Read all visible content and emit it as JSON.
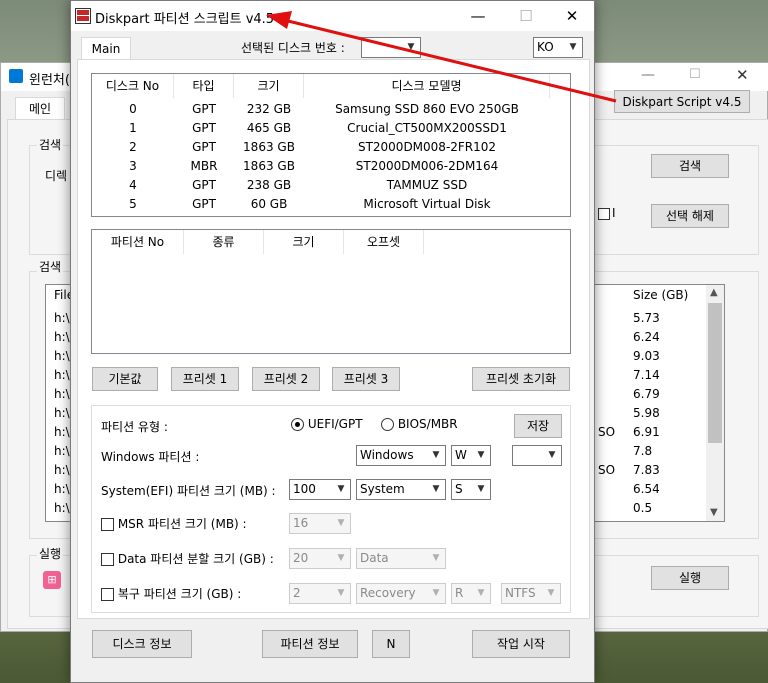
{
  "back_window": {
    "title": "윈런처(",
    "tab_main": "메인",
    "group_search_label": "검색 ",
    "directory_label": "디렉",
    "group_results_label": "검색 ",
    "search_button": "검색",
    "deselect_button": "선택 해제",
    "checkbox_suffix": "I",
    "list_header_file": "File",
    "list_header_size": "Size (GB)",
    "rows": [
      {
        "file": "h:\\",
        "mid": "",
        "size": "5.73"
      },
      {
        "file": "h:\\",
        "mid": "",
        "size": "6.24"
      },
      {
        "file": "h:\\",
        "mid": "",
        "size": "9.03"
      },
      {
        "file": "h:\\",
        "mid": "",
        "size": "7.14"
      },
      {
        "file": "h:\\",
        "mid": "",
        "size": "6.79"
      },
      {
        "file": "h:\\",
        "mid": "",
        "size": "5.98"
      },
      {
        "file": "h:\\",
        "mid": "SO",
        "size": "6.91"
      },
      {
        "file": "h:\\",
        "mid": "",
        "size": "7.8"
      },
      {
        "file": "h:\\",
        "mid": "SO",
        "size": "7.83"
      },
      {
        "file": "h:\\",
        "mid": "",
        "size": "6.54"
      },
      {
        "file": "h:\\",
        "mid": "",
        "size": "0.5"
      }
    ],
    "group_run_label": "실행 ",
    "run_button": "실행",
    "callout_label": "Diskpart Script v4.5"
  },
  "window": {
    "title": "Diskpart 파티션 스크립트 v4.5",
    "minimize": "—",
    "maximize": "☐",
    "close": "✕"
  },
  "tab_main": "Main",
  "disk_select_label": "선택된 디스크 번호 :",
  "disk_select_value": "",
  "lang_value": "KO",
  "disk_table": {
    "headers": [
      "디스크 No",
      "타입",
      "크기",
      "디스크 모델명"
    ],
    "rows": [
      [
        "0",
        "GPT",
        "232 GB",
        "Samsung SSD 860 EVO 250GB"
      ],
      [
        "1",
        "GPT",
        "465 GB",
        "Crucial_CT500MX200SSD1"
      ],
      [
        "2",
        "GPT",
        "1863 GB",
        "ST2000DM008-2FR102"
      ],
      [
        "3",
        "MBR",
        "1863 GB",
        "ST2000DM006-2DM164"
      ],
      [
        "4",
        "GPT",
        "238 GB",
        "TAMMUZ SSD"
      ],
      [
        "5",
        "GPT",
        "60 GB",
        "Microsoft Virtual Disk"
      ]
    ]
  },
  "partition_table": {
    "headers": [
      "파티션 No",
      "종류",
      "크기",
      "오프셋"
    ]
  },
  "presets": {
    "default": "기본값",
    "preset1": "프리셋 1",
    "preset2": "프리셋 2",
    "preset3": "프리셋 3",
    "reset": "프리셋 초기화"
  },
  "options": {
    "partition_type_label": "파티션 유형 :",
    "uefi": "UEFI/GPT",
    "bios": "BIOS/MBR",
    "save": "저장",
    "windows_partition_label": "Windows 파티션 :",
    "windows_name": "Windows",
    "windows_letter": "W",
    "windows_extra": "",
    "efi_label": "System(EFI) 파티션 크기 (MB) :",
    "efi_size": "100",
    "efi_name": "System",
    "efi_letter": "S",
    "msr_label": "MSR 파티션 크기 (MB) :",
    "msr_size": "16",
    "data_label": "Data 파티션 분할 크기 (GB) :",
    "data_size": "20",
    "data_name": "Data",
    "recovery_label": "복구 파티션 크기 (GB) :",
    "recovery_size": "2",
    "recovery_name": "Recovery",
    "recovery_letter": "R",
    "recovery_fs": "NTFS"
  },
  "bottom": {
    "disk_info": "디스크 정보",
    "partition_info": "파티션 정보",
    "n_button": "N",
    "start": "작업 시작"
  },
  "colors": {
    "arrow": "#e01010",
    "accent_launcher": "#0078d7",
    "pink_icon": "#f06292"
  }
}
